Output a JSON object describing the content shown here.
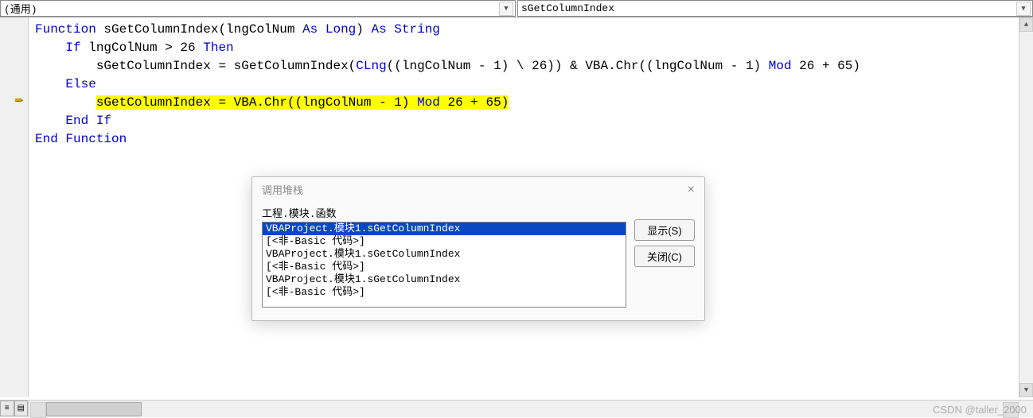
{
  "dropdowns": {
    "left": "(通用)",
    "right": "sGetColumnIndex"
  },
  "code": {
    "l1": {
      "kw1": "Function",
      "fn": " sGetColumnIndex(lngColNum ",
      "kw2": "As Long",
      "p2": ") ",
      "kw3": "As String"
    },
    "l2": {
      "kw": "If",
      "body": " lngColNum > 26 ",
      "kw2": "Then"
    },
    "l3": {
      "a": "sGetColumnIndex = sGetColumnIndex(",
      "kw": "CLng",
      "b": "((lngColNum - 1) \\ 26)) & VBA.Chr((lngColNum - 1) ",
      "kw2": "Mod",
      "c": " 26 + 65)"
    },
    "l4": {
      "kw": "Else"
    },
    "l5": {
      "a": "sGetColumnIndex = VBA.Chr((lngColNum - 1) ",
      "kw": "Mod",
      "b": " 26 + 65)"
    },
    "l6": {
      "kw": "End If"
    },
    "l7": {
      "kw": "End Function"
    }
  },
  "dialog": {
    "title": "调用堆栈",
    "label": "工程.模块.函数",
    "items": [
      "VBAProject.模块1.sGetColumnIndex",
      "[<非-Basic 代码>]",
      "VBAProject.模块1.sGetColumnIndex",
      "[<非-Basic 代码>]",
      "VBAProject.模块1.sGetColumnIndex",
      "[<非-Basic 代码>]"
    ],
    "btn_show": "显示(S)",
    "btn_close": "关闭(C)"
  },
  "watermark": "CSDN @taller_2000"
}
